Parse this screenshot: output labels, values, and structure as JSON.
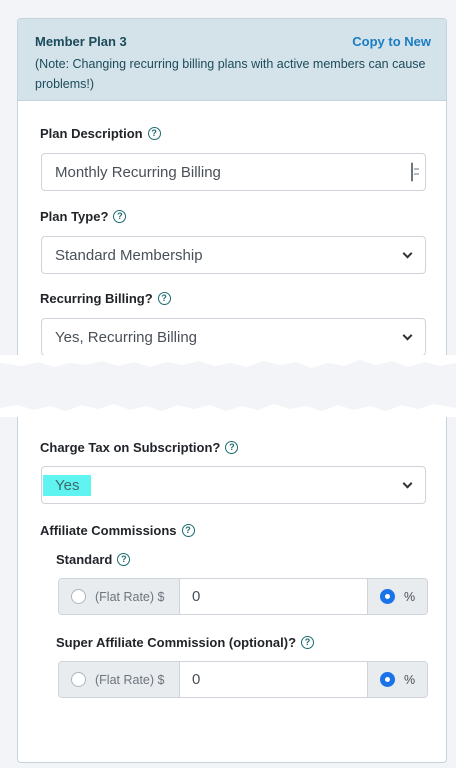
{
  "header": {
    "title": "Member Plan 3",
    "copy_link": "Copy to New",
    "note": "(Note: Changing recurring billing plans with active members can cause problems!)"
  },
  "fields": {
    "plan_description": {
      "label": "Plan Description",
      "value": "Monthly Recurring Billing"
    },
    "plan_type": {
      "label": "Plan Type?",
      "value": "Standard Membership"
    },
    "recurring_billing": {
      "label": "Recurring Billing?",
      "value": "Yes, Recurring Billing"
    },
    "charge_tax": {
      "label": "Charge Tax on Subscription?",
      "value": "Yes"
    }
  },
  "affiliate": {
    "heading": "Affiliate Commissions",
    "standard": {
      "label": "Standard",
      "flat_rate_label": "(Flat Rate) $",
      "value": "0",
      "percent_label": "%",
      "selected": "percent"
    },
    "super": {
      "label": "Super Affiliate Commission (optional)?",
      "flat_rate_label": "(Flat Rate) $",
      "value": "0",
      "percent_label": "%",
      "selected": "percent"
    }
  },
  "icons": {
    "help": "question-circle-icon",
    "dropdown": "chevron-down-icon",
    "field_addon": "document-icon"
  },
  "colors": {
    "header_bg": "#d4e3e9",
    "link": "#1a7dc4",
    "radio_selected": "#1a73e8",
    "highlight": "#5ff4ef"
  }
}
